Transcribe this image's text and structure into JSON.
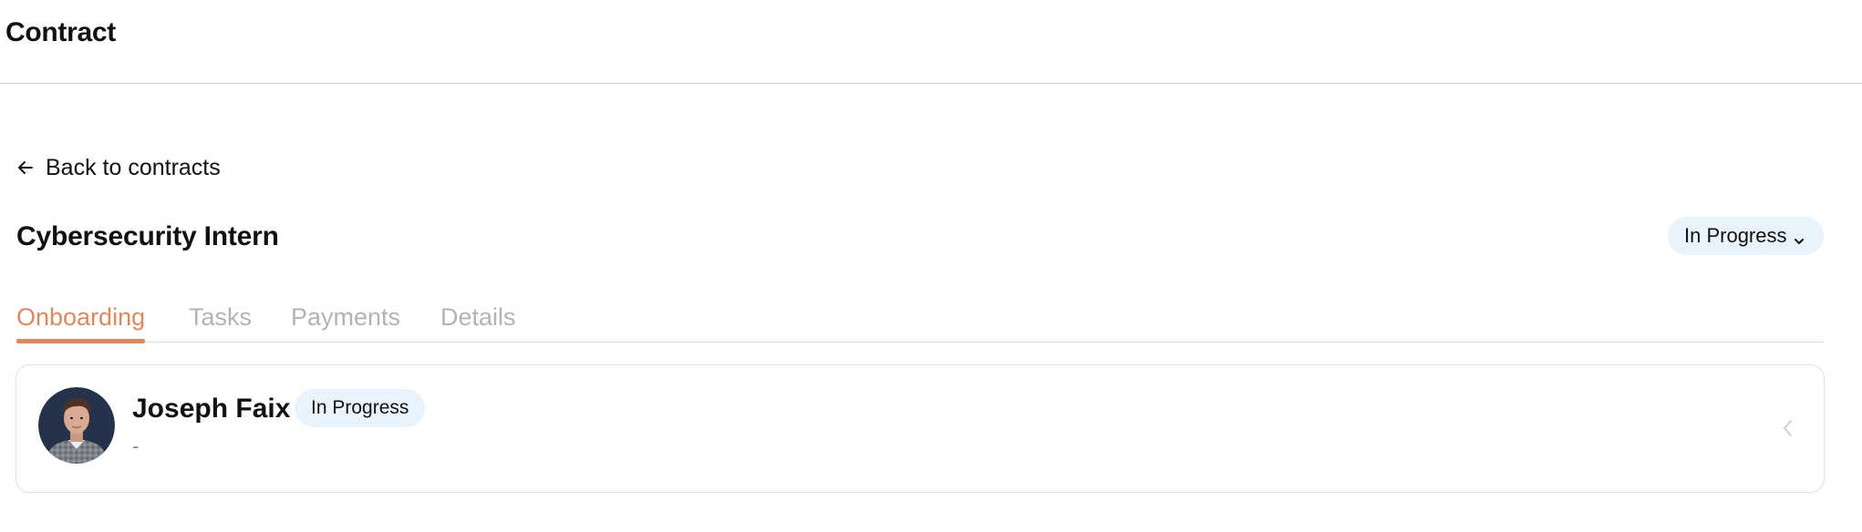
{
  "header": {
    "title": "Contract"
  },
  "back_link": {
    "label": "Back to contracts",
    "icon": "arrow-left-icon"
  },
  "contract": {
    "title": "Cybersecurity Intern",
    "status": "In Progress"
  },
  "tabs": [
    {
      "label": "Onboarding",
      "active": true
    },
    {
      "label": "Tasks",
      "active": false
    },
    {
      "label": "Payments",
      "active": false
    },
    {
      "label": "Details",
      "active": false
    }
  ],
  "contractor": {
    "name": "Joseph Faix",
    "status": "In Progress",
    "subtitle": "-"
  },
  "colors": {
    "accent": "#d98a5f",
    "badge_bg": "#e8f3fc",
    "inactive_tab": "#b3b3b3"
  }
}
